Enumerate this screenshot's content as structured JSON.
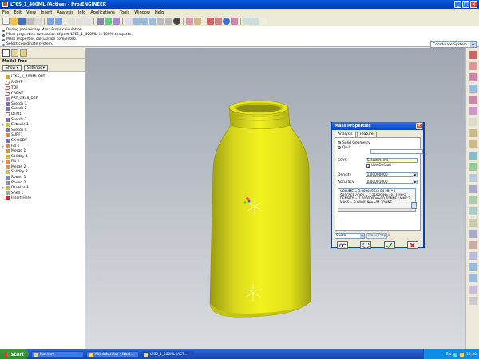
{
  "window": {
    "title": "LT65_1_400ML (Active) - Pro/ENGINEER"
  },
  "menu": [
    "File",
    "Edit",
    "View",
    "Insert",
    "Analysis",
    "Info",
    "Applications",
    "Tools",
    "Window",
    "Help"
  ],
  "messages": [
    {
      "text": "During preliminary Mass Props calculation.",
      "kind": "info"
    },
    {
      "text": "Mass properties calculation of part 'LT65_1_400ML' is 100% complete.",
      "kind": "info"
    },
    {
      "text": "Mass Properties calculation completed.",
      "kind": "info"
    },
    {
      "text": "Select coordinate system.",
      "kind": "ok"
    }
  ],
  "filter": {
    "value": "Coordinate System"
  },
  "model_tree": {
    "header": "Model Tree",
    "show_label": "Show",
    "settings_label": "Settings",
    "items": [
      {
        "label": "LT65_1_400ML.PRT",
        "icon": "part",
        "expand": ""
      },
      {
        "label": "RIGHT",
        "icon": "plane",
        "expand": ""
      },
      {
        "label": "TOP",
        "icon": "plane",
        "expand": ""
      },
      {
        "label": "FRONT",
        "icon": "plane",
        "expand": ""
      },
      {
        "label": "PRT_CSYS_DEF",
        "icon": "csys",
        "expand": ""
      },
      {
        "label": "Sketch 1",
        "icon": "sketch",
        "expand": ""
      },
      {
        "label": "Sketch 2",
        "icon": "sketch",
        "expand": ""
      },
      {
        "label": "DTM1",
        "icon": "plane",
        "expand": ""
      },
      {
        "label": "Sketch 3",
        "icon": "sketch",
        "expand": ""
      },
      {
        "label": "Extrude 1",
        "icon": "feature",
        "expand": "+"
      },
      {
        "label": "Sketch 4",
        "icon": "sketch",
        "expand": ""
      },
      {
        "label": "SURF1",
        "icon": "surface",
        "expand": ""
      },
      {
        "label": "SK BODY",
        "icon": "sketch",
        "expand": ""
      },
      {
        "label": "Fill 1",
        "icon": "surface",
        "expand": "+"
      },
      {
        "label": "Merge 1",
        "icon": "surface",
        "expand": ""
      },
      {
        "label": "Solidify 1",
        "icon": "feature",
        "expand": ""
      },
      {
        "label": "Fill 2",
        "icon": "surface",
        "expand": "+"
      },
      {
        "label": "Merge 2",
        "icon": "surface",
        "expand": ""
      },
      {
        "label": "Solidify 2",
        "icon": "feature",
        "expand": ""
      },
      {
        "label": "Round 1",
        "icon": "round",
        "expand": ""
      },
      {
        "label": "Round 2",
        "icon": "round",
        "expand": ""
      },
      {
        "label": "Revolve 1",
        "icon": "feature",
        "expand": "+"
      },
      {
        "label": "Shell 1",
        "icon": "shell",
        "expand": ""
      },
      {
        "label": "Insert Here",
        "icon": "insert",
        "expand": ""
      }
    ]
  },
  "mass_dialog": {
    "title": "Mass Properties",
    "tabs": [
      "Analysis",
      "Feature"
    ],
    "solid_label": "Solid Geometry",
    "quilt_label": "Quilt",
    "csys_label": "CSYS",
    "csys_value": "Select items",
    "use_default_label": "Use Default",
    "density_label": "Density",
    "density_value": "1.00000000",
    "accuracy_label": "Accuracy",
    "accuracy_value": "0.00001000",
    "results": [
      "VOLUME = 3.0000196e+04 MM^3",
      "SURFACE AREA = 7.3152946e+04 MM^2",
      "DENSITY = 1.0000000e+00 TONNE / MM^3",
      "MASS = 3.0000196e+04 TONNE"
    ],
    "mode_value": "Quick",
    "name_value": "Mass_Prop_1"
  },
  "taskbar": {
    "start_label": "start",
    "tasks": [
      {
        "label": "Machine",
        "active": false
      },
      {
        "label": "Administrator - Wind...",
        "active": false
      },
      {
        "label": "LT65_1_400ML (ACT...",
        "active": true
      }
    ],
    "lang": "EN",
    "clock": "14:30"
  },
  "colors": {
    "bottle": "#e8e81c",
    "viewport_top": "#a0a7b2",
    "viewport_bottom": "#d9dce0",
    "title_blue": "#0a46c4"
  }
}
